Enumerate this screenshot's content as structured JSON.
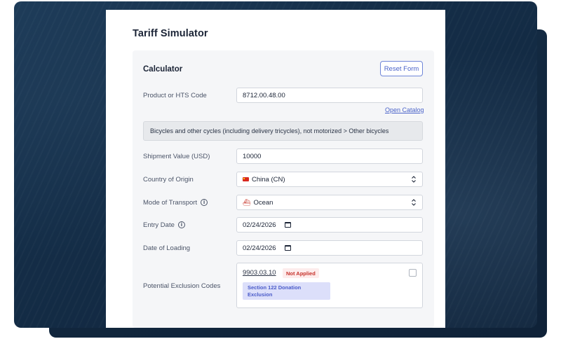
{
  "app": {
    "title": "Tariff Simulator"
  },
  "calculator": {
    "section_title": "Calculator",
    "reset_label": "Reset Form",
    "product": {
      "label": "Product or HTS Code",
      "value": "8712.00.48.00",
      "catalog_link": "Open Catalog",
      "description": "Bicycles and other cycles (including delivery tricycles), not motorized > Other bicycles"
    },
    "shipment_value": {
      "label": "Shipment Value (USD)",
      "value": "10000"
    },
    "country_of_origin": {
      "label": "Country of Origin",
      "value": "China (CN)",
      "icon": "china-flag-icon"
    },
    "mode_of_transport": {
      "label": "Mode of Transport",
      "value": "Ocean",
      "icon": "ship-icon"
    },
    "entry_date": {
      "label": "Entry Date",
      "value": "02/24/2026"
    },
    "date_of_loading": {
      "label": "Date of Loading",
      "value": "02/24/2026"
    },
    "exclusions": {
      "label": "Potential Exclusion Codes",
      "items": [
        {
          "code": "9903.03.10",
          "status": "Not Applied",
          "description": "Section 122 Donation Exclusion",
          "checked": false
        }
      ]
    }
  },
  "colors": {
    "accent": "#4a63c9",
    "backdrop": "#142d47",
    "badge_red": "#c6312a",
    "tag_bg": "#dcdffa"
  }
}
